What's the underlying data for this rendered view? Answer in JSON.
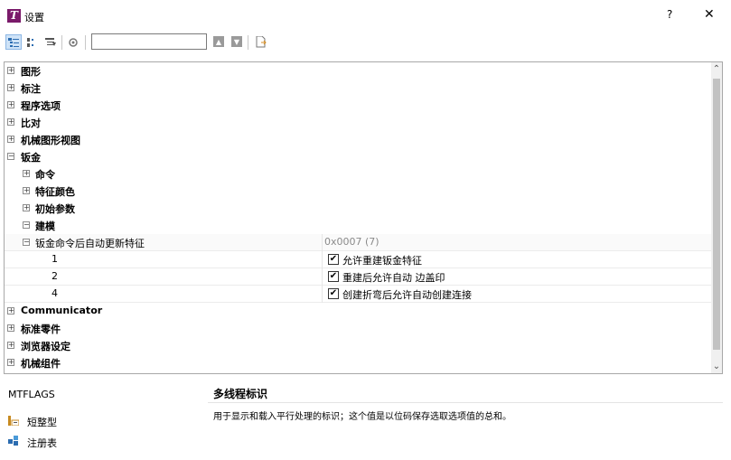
{
  "window": {
    "title": "设置",
    "help": "?",
    "close": "✕"
  },
  "search": {
    "value": ""
  },
  "tree": {
    "rows": [
      {
        "label": "图形",
        "toggle": "+"
      },
      {
        "label": "标注",
        "toggle": "+"
      },
      {
        "label": "程序选项",
        "toggle": "+"
      },
      {
        "label": "比对",
        "toggle": "+"
      },
      {
        "label": "机械图形视图",
        "toggle": "+"
      },
      {
        "label": "钣金",
        "toggle": "−"
      },
      {
        "label": "命令",
        "toggle": "+"
      },
      {
        "label": "特征颜色",
        "toggle": "+"
      },
      {
        "label": "初始参数",
        "toggle": "+"
      },
      {
        "label": "建模",
        "toggle": "−"
      }
    ],
    "property": {
      "label": "钣金命令后自动更新特征",
      "value": "0x0007 (7)",
      "toggle": "−"
    },
    "flags": [
      {
        "num": "1",
        "check": "✔",
        "label": "允许重建钣金特征"
      },
      {
        "num": "2",
        "check": "✔",
        "label": "重建后允许自动 边盖印"
      },
      {
        "num": "4",
        "check": "✔",
        "label": "创建折弯后允许自动创建连接"
      }
    ],
    "rows_after": [
      {
        "label": "Communicator",
        "toggle": "+"
      },
      {
        "label": "标准零件",
        "toggle": "+"
      },
      {
        "label": "浏览器设定",
        "toggle": "+"
      },
      {
        "label": "机械组件",
        "toggle": "+"
      }
    ]
  },
  "info": {
    "key": "MTFLAGS",
    "title": "多线程标识",
    "description": "用于显示和载入平行处理的标识；这个值是以位码保存选取选项值的总和。",
    "type_label": "短整型",
    "registry_label": "注册表"
  }
}
